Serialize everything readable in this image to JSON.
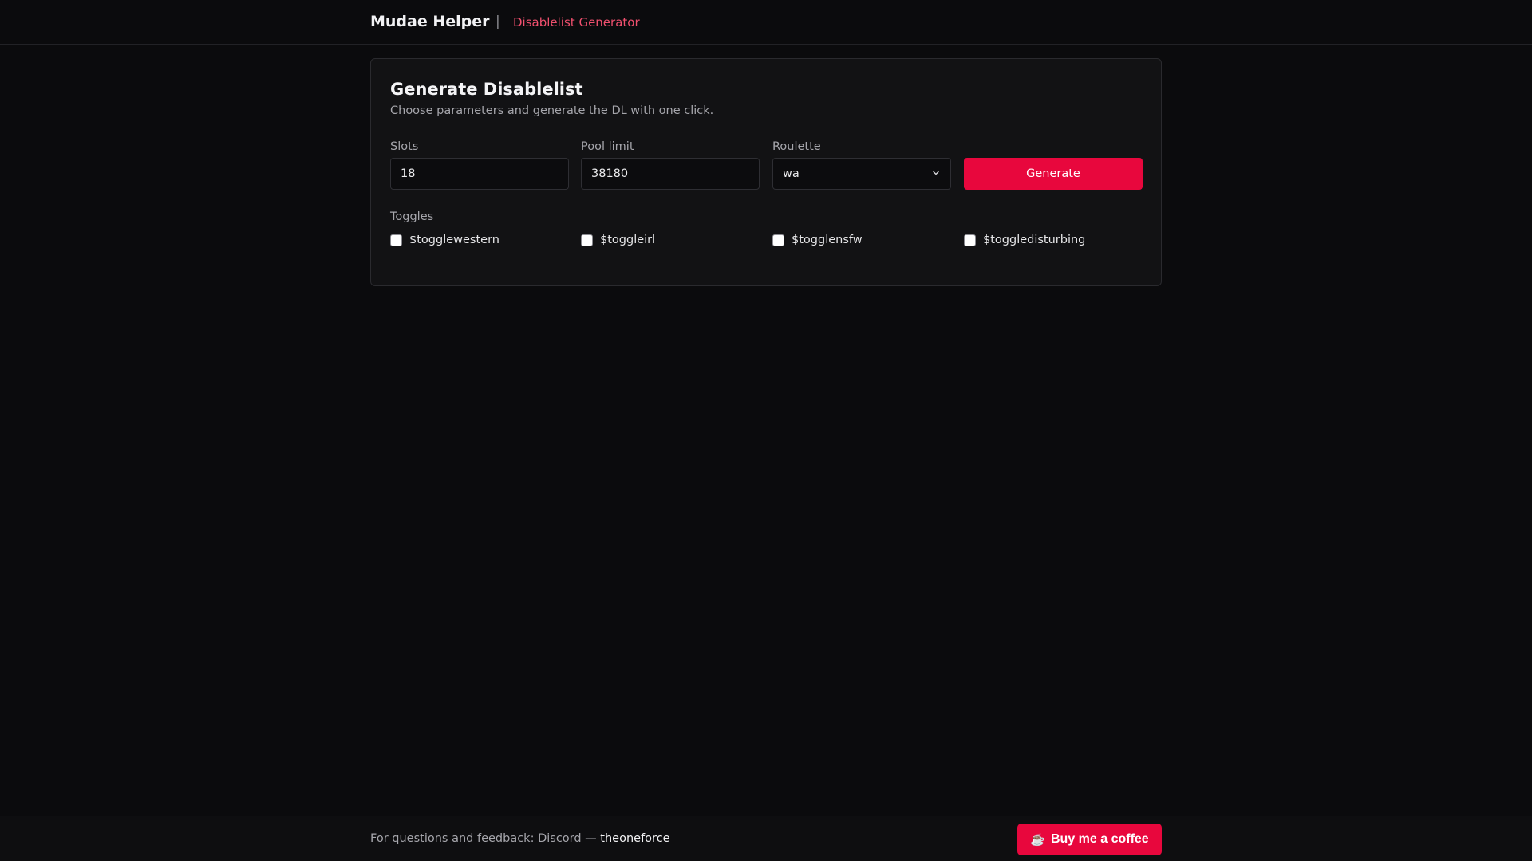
{
  "header": {
    "brand": "Mudae Helper",
    "separator": "|",
    "nav_link": "Disablelist Generator"
  },
  "card": {
    "title": "Generate Disablelist",
    "subtitle": "Choose parameters and generate the DL with one click.",
    "fields": {
      "slots": {
        "label": "Slots",
        "value": "18"
      },
      "pool_limit": {
        "label": "Pool limit",
        "value": "38180"
      },
      "roulette": {
        "label": "Roulette",
        "value": "wa"
      }
    },
    "generate_label": "Generate",
    "toggles_label": "Toggles",
    "toggles": [
      {
        "label": "$togglewestern",
        "checked": false
      },
      {
        "label": "$toggleirl",
        "checked": false
      },
      {
        "label": "$togglensfw",
        "checked": false
      },
      {
        "label": "$toggledisturbing",
        "checked": false
      }
    ]
  },
  "footer": {
    "text": "For questions and feedback: Discord — ",
    "discord_user": "theoneforce",
    "coffee_label": "Buy me a coffee",
    "coffee_icon": "coffee-cup-icon"
  },
  "colors": {
    "accent": "#e8073d",
    "accent_link": "#f0506e",
    "background": "#0b0b0d",
    "card": "#121214"
  }
}
